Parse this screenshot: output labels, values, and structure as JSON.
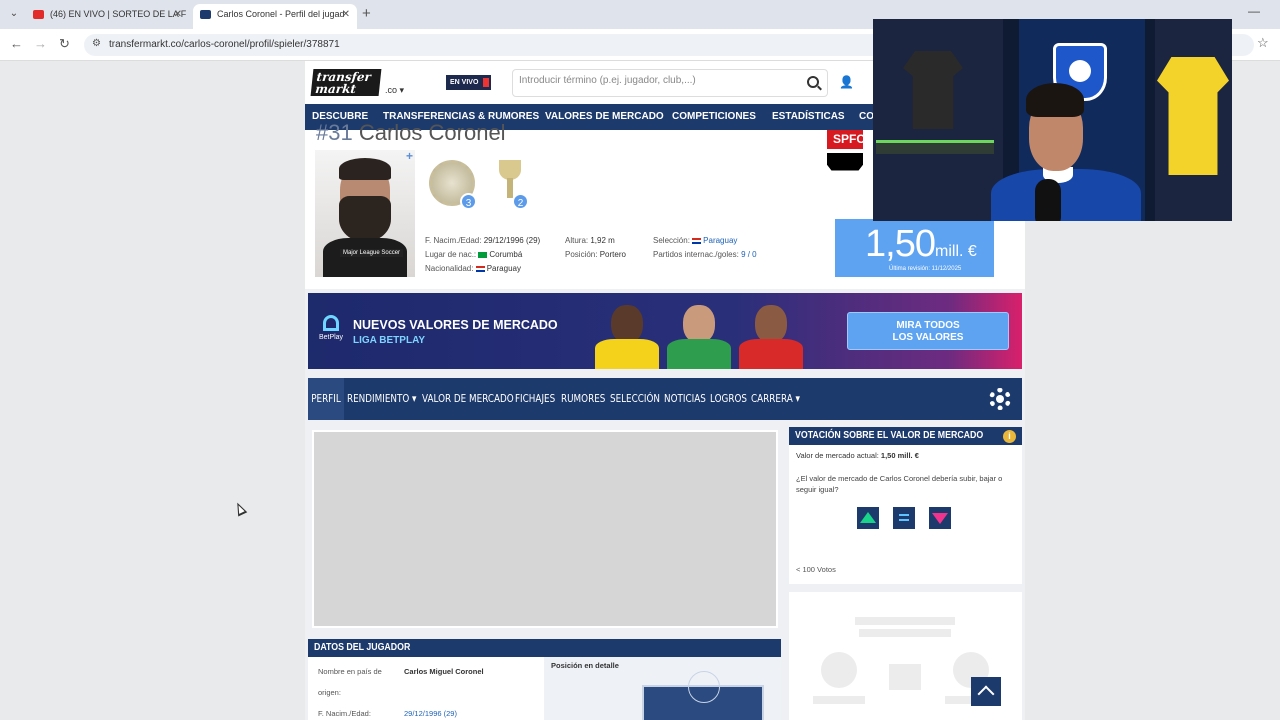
{
  "browser": {
    "tabs": [
      {
        "title": "(46) EN VIVO | SORTEO DE LA F",
        "favicon": "youtube-icon"
      },
      {
        "title": "Carlos Coronel - Perfil del jugad",
        "favicon": "transfermarkt-icon"
      }
    ],
    "url": "transfermarkt.co/carlos-coronel/profil/spieler/378871"
  },
  "header": {
    "logo_line1": "transfer",
    "logo_line2": "markt",
    "tld": ".co",
    "live_label": "EN VIVO",
    "search_placeholder": "Introducir término (p.ej. jugador, club,...)"
  },
  "nav": [
    "DESCUBRE",
    "TRANSFERENCIAS & RUMORES",
    "VALORES DE MERCADO",
    "COMPETICIONES",
    "ESTADÍSTICAS",
    "CO"
  ],
  "player": {
    "number": "#31",
    "name": "Carlos Coronel",
    "photo_caption": "Major League Soccer",
    "trophies": [
      {
        "count": "3"
      },
      {
        "count": "2"
      }
    ],
    "birth_label": "F. Nacim./Edad:",
    "birth_value": "29/12/1996 (29)",
    "place_label": "Lugar de nac.:",
    "place_value": "Corumbá",
    "nationality_label": "Nacionalidad:",
    "nationality_value": "Paraguay",
    "height_label": "Altura:",
    "height_value": "1,92 m",
    "position_label": "Posición:",
    "position_value": "Portero",
    "selection_label": "Selección:",
    "selection_value": "Paraguay",
    "intl_label": "Partidos internac./goles:",
    "intl_value": "9 / 0",
    "club_crest": "SPFC",
    "market_value": "1,50",
    "market_unit": "mill. €",
    "last_review": "Última revisión: 11/12/2025"
  },
  "banner": {
    "logo_text": "BetPlay",
    "title": "NUEVOS VALORES DE MERCADO",
    "subtitle": "LIGA BETPLAY",
    "button_line1": "MIRA TODOS",
    "button_line2": "LOS VALORES"
  },
  "subnav": [
    "PERFIL",
    "RENDIMIENTO ▾",
    "VALOR DE MERCADO",
    "FICHAJES",
    "RUMORES",
    "SELECCIÓN",
    "NOTICIAS",
    "LOGROS",
    "CARRERA ▾"
  ],
  "vote": {
    "title": "VOTACIÓN SOBRE EL VALOR DE MERCADO",
    "current_label": "Valor de mercado actual:",
    "current_value": "1,50 mill. €",
    "question": "¿El valor de mercado de Carlos Coronel debería subir, bajar o seguir igual?",
    "votes": "< 100 Votos"
  },
  "datos": {
    "title": "DATOS DEL JUGADOR",
    "name_label_1": "Nombre en país de",
    "name_label_2": "origen:",
    "name_value": "Carlos Miguel Coronel",
    "birth_label": "F. Nacim./Edad:",
    "birth_value": "29/12/1996 (29)",
    "position_title": "Posición en detalle"
  },
  "colors": {
    "navy": "#1d3a6d",
    "market_blue": "#5ea3f2",
    "vote_up": "#1ad38a",
    "vote_down": "#f0348d"
  }
}
